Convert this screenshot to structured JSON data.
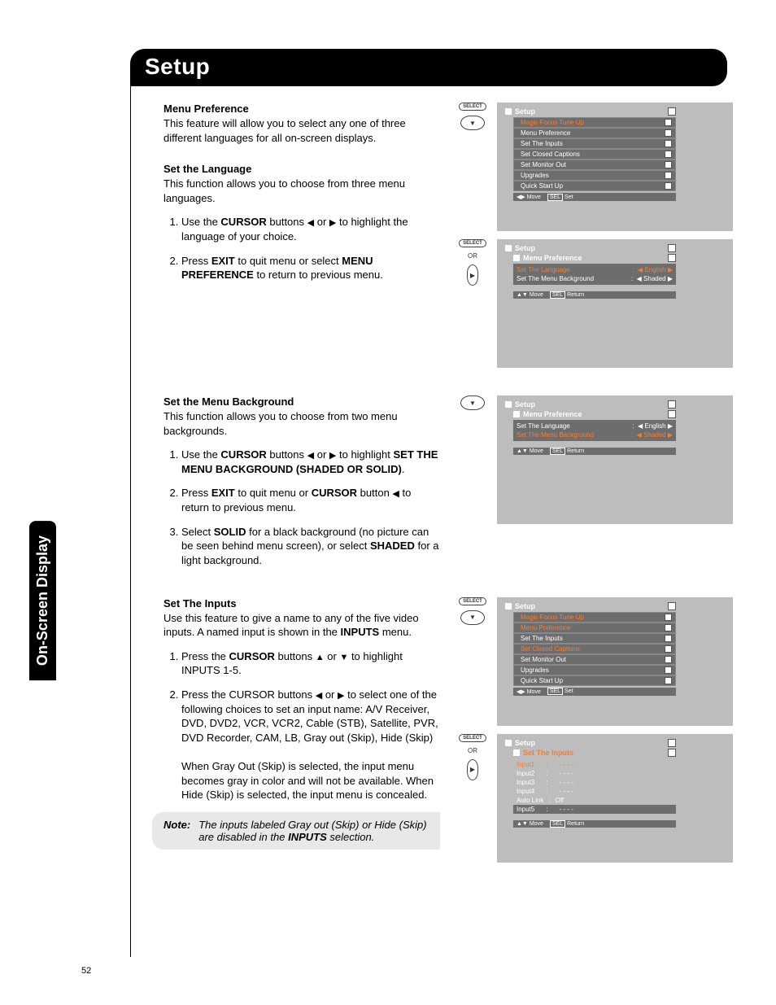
{
  "page_number": "52",
  "section_title": "Setup",
  "side_tab": "On-Screen Display",
  "glyphs": {
    "left": "◀",
    "right": "▶",
    "up": "▲",
    "down": "▼"
  },
  "remote": {
    "select": "SELECT",
    "or": "OR"
  },
  "sections": {
    "menu_pref": {
      "heading": "Menu Preference",
      "body": "This feature will allow you to select any one of three different languages for all on-screen displays."
    },
    "set_language": {
      "heading": "Set the Language",
      "body": "This function allows you to choose from three menu languages.",
      "step1_pre": "Use the ",
      "step1_cursor": "CURSOR",
      "step1_mid": " buttons ",
      "step1_post": " to highlight the language of your choice.",
      "step2_pre": "Press ",
      "step2_exit": "EXIT",
      "step2_mid": " to quit menu or select ",
      "step2_mp": "MENU PREFERENCE",
      "step2_post": " to return to previous menu."
    },
    "set_bg": {
      "heading": "Set the Menu Background",
      "body": "This function allows you to choose from two menu backgrounds.",
      "step1_pre": "Use the ",
      "step1_cursor": "CURSOR",
      "step1_mid": " buttons ",
      "step1_post": " to highlight ",
      "step1_bold": "SET THE MENU BACKGROUND (SHADED OR SOLID)",
      "step1_end": ".",
      "step2_pre": "Press ",
      "step2_exit": "EXIT",
      "step2_mid": " to quit menu or ",
      "step2_cursor": "CURSOR",
      "step2_mid2": " button ",
      "step2_post": " to return to previous menu.",
      "step3_pre": "Select ",
      "step3_solid": "SOLID",
      "step3_mid": " for a black background (no picture can be seen behind menu screen), or select ",
      "step3_shaded": "SHADED",
      "step3_post": " for a light background."
    },
    "set_inputs": {
      "heading": "Set The Inputs",
      "body_pre": "Use this feature to give a name to any of the five video inputs. A named input is shown in the ",
      "body_bold": "INPUTS",
      "body_post": " menu.",
      "step1_pre": "Press the ",
      "step1_cursor": "CURSOR",
      "step1_mid": " buttons  ",
      "step1_post": " to highlight INPUTS 1-5.",
      "step2a": "Press the CURSOR buttons ",
      "step2b": " to select one of the following choices to set an input name: A/V Receiver, DVD, DVD2, VCR, VCR2, Cable (STB), Satellite, PVR, DVD Recorder, CAM, LB, Gray out (Skip), Hide (Skip)",
      "step2c": "When Gray Out (Skip) is selected, the input menu becomes gray in color and will not be available. When Hide (Skip) is selected, the input menu is concealed."
    },
    "note": {
      "label": "Note:",
      "text_pre": "The inputs labeled Gray out (Skip) or Hide (Skip) are disabled in the ",
      "text_bold": "INPUTS",
      "text_post": " selection."
    }
  },
  "osd": {
    "setup_title": "Setup",
    "menu_pref_title": "Menu Preference",
    "set_inputs_title": "Set The Inputs",
    "menu_items": [
      "Magic Focus Tune Up",
      "Menu Preference",
      "Set The Inputs",
      "Set Closed Captions",
      "Set Monitor Out",
      "Upgrades",
      "Quick Start Up"
    ],
    "help_move": "Move",
    "help_sel": "SEL",
    "help_set": "Set",
    "help_return": "Return",
    "lang_row": {
      "label": "Set The Language",
      "value": "English"
    },
    "bg_row": {
      "label": "Set The Menu Background",
      "value": "Shaded"
    },
    "inputs": [
      {
        "label": "Input1",
        "value": "- - - -"
      },
      {
        "label": "Input2",
        "value": "- - - -"
      },
      {
        "label": "Input3",
        "value": "- - - -"
      },
      {
        "label": "Input4",
        "value": "- - - -"
      },
      {
        "label": "Auto Link",
        "value": "Off"
      },
      {
        "label": "Input5",
        "value": "- - - -"
      }
    ]
  }
}
